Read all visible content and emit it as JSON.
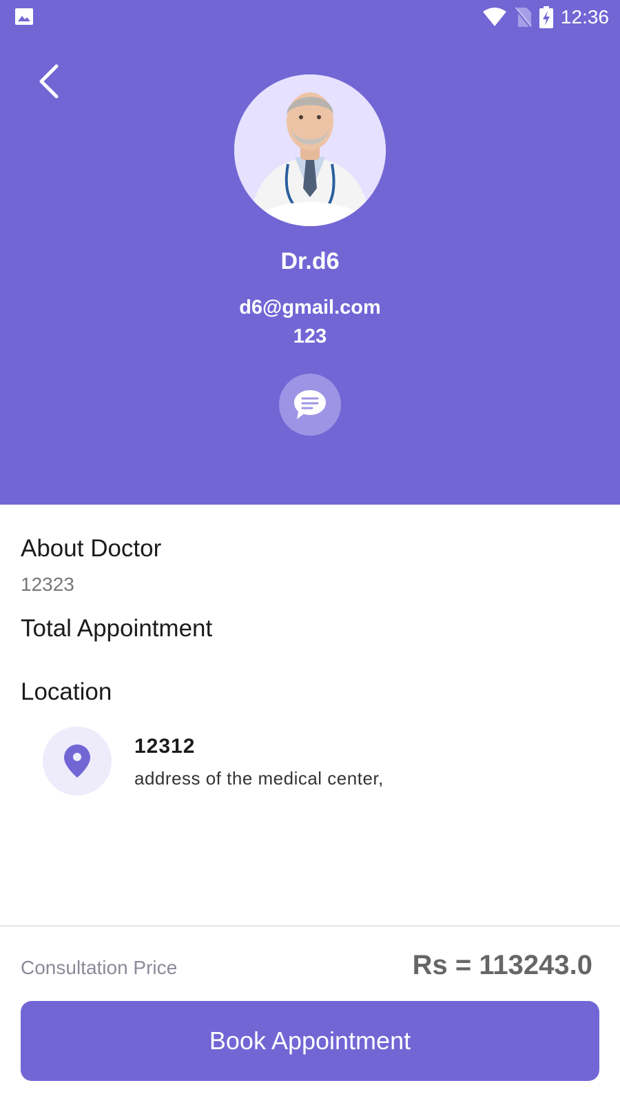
{
  "status_bar": {
    "time": "12:36",
    "icons": [
      "gallery-icon",
      "wifi-icon",
      "no-sim-icon",
      "battery-charging-icon"
    ]
  },
  "colors": {
    "primary": "#7266D5",
    "chat_button": "#9D94E5",
    "location_bg": "#EEEBFB",
    "avatar_bg": "#E6E1FF"
  },
  "header": {
    "back_icon": "chevron-left-icon",
    "chat_icon": "chat-bubble-icon"
  },
  "doctor": {
    "name": "Dr.d6",
    "email": "d6@gmail.com",
    "phone": "123"
  },
  "about": {
    "title": "About Doctor",
    "text": "12323"
  },
  "total_appointment": {
    "title": "Total Appointment"
  },
  "location": {
    "title": "Location",
    "icon": "map-pin-icon",
    "name": "12312",
    "address": "address of the medical center,"
  },
  "footer": {
    "price_label": "Consultation Price",
    "price_value": "Rs = 113243.0",
    "book_label": "Book Appointment"
  }
}
